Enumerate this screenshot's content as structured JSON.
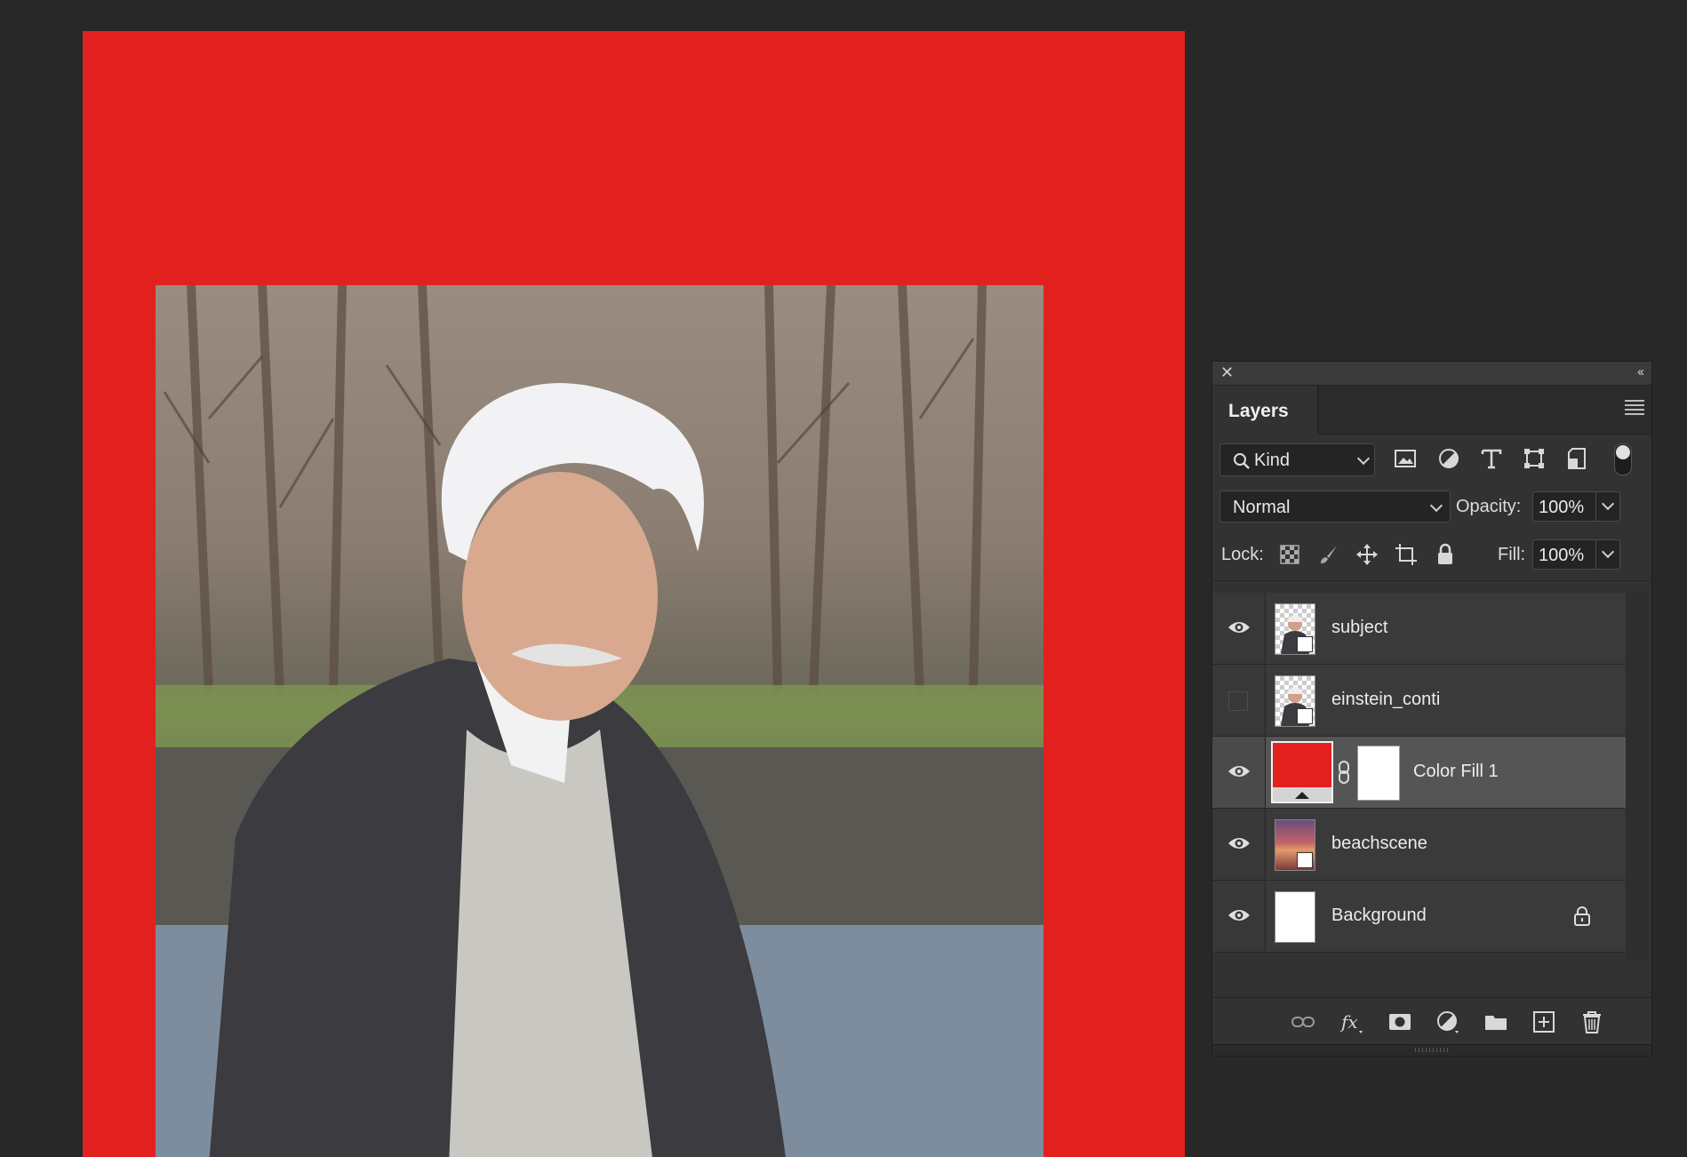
{
  "canvas": {
    "fill_color": "#e2211f"
  },
  "panel": {
    "close_symbol": "✕",
    "collapse_symbol": "‹‹",
    "tab_title": "Layers",
    "filter": {
      "kind_label": "Kind",
      "icons": [
        "image-filter-icon",
        "adjustment-filter-icon",
        "type-filter-icon",
        "shape-filter-icon",
        "smart-object-filter-icon"
      ]
    },
    "blend_mode": "Normal",
    "opacity_label": "Opacity:",
    "opacity_value": "100%",
    "lock_label": "Lock:",
    "fill_label": "Fill:",
    "fill_value": "100%",
    "layers": [
      {
        "name": "subject",
        "visible": true
      },
      {
        "name": "einstein_conti",
        "visible": false
      },
      {
        "name": "Color Fill 1",
        "visible": true,
        "selected": true,
        "fill_color": "#e2211f"
      },
      {
        "name": "beachscene",
        "visible": true
      },
      {
        "name": "Background",
        "visible": true,
        "locked": true
      }
    ],
    "footer_icons": [
      "link-layers-icon",
      "fx-icon",
      "add-mask-icon",
      "adjustment-layer-icon",
      "new-group-icon",
      "new-layer-icon",
      "delete-layer-icon"
    ]
  }
}
